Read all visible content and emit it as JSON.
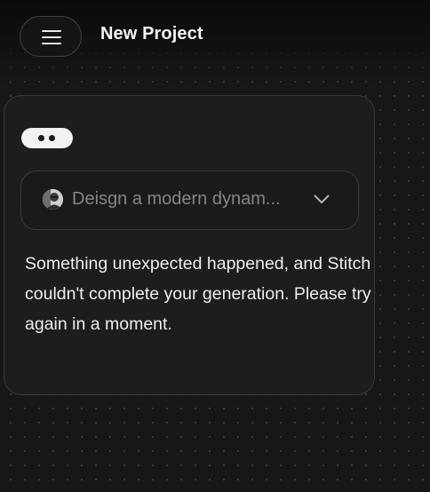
{
  "header": {
    "menu_icon": "hamburger-menu-icon",
    "title": "New Project"
  },
  "card": {
    "status_indicator": "loading-dots",
    "prompt_selector": {
      "avatar_icon": "user-avatar",
      "value": "Deisgn a modern dynam...",
      "dropdown_icon": "chevron-down-icon"
    },
    "error_message": "Something unexpected happened, and Stitch couldn't complete your generation. Please try again in a moment."
  },
  "colors": {
    "background": "#171719",
    "card_background": "#1d1d1f",
    "card_border": "#38393d",
    "text_primary": "#ececee",
    "text_muted": "#85858b",
    "pill": "#f2f2f3"
  }
}
